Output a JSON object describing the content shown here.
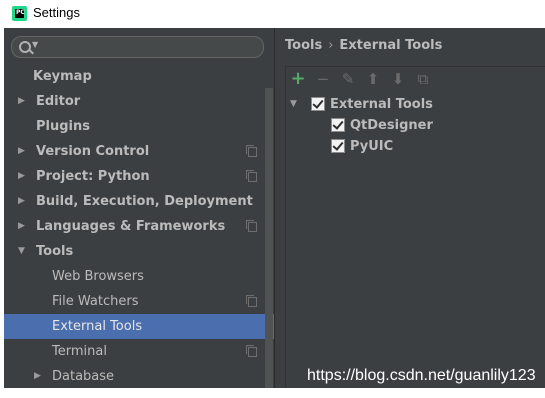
{
  "window": {
    "title": "Settings",
    "app_icon_text": "PC"
  },
  "search": {
    "placeholder": ""
  },
  "sidebar": {
    "items": [
      {
        "label": "Keymap",
        "arrow": ""
      },
      {
        "label": "Editor",
        "arrow": "▶"
      },
      {
        "label": "Plugins",
        "arrow": ""
      },
      {
        "label": "Version Control",
        "arrow": "▶"
      },
      {
        "label": "Project: Python",
        "arrow": "▶"
      },
      {
        "label": "Build, Execution, Deployment",
        "arrow": "▶"
      },
      {
        "label": "Languages & Frameworks",
        "arrow": "▶"
      },
      {
        "label": "Tools",
        "arrow": "▼"
      },
      {
        "label": "Web Browsers",
        "arrow": ""
      },
      {
        "label": "File Watchers",
        "arrow": ""
      },
      {
        "label": "External Tools",
        "arrow": "",
        "selected": true
      },
      {
        "label": "Terminal",
        "arrow": ""
      },
      {
        "label": "Database",
        "arrow": "▶"
      }
    ]
  },
  "breadcrumb": {
    "parent": "Tools",
    "separator": "›",
    "current": "External Tools"
  },
  "toolbar": {
    "add": "+",
    "remove": "−",
    "edit": "✎",
    "up": "⬆",
    "down": "⬇",
    "copy": "⧉"
  },
  "tools_tree": {
    "group": {
      "label": "External Tools",
      "arrow": "▼",
      "checked": true
    },
    "items": [
      {
        "label": "QtDesigner",
        "checked": true
      },
      {
        "label": "PyUIC",
        "checked": true
      }
    ]
  },
  "watermark": "https://blog.csdn.net/guanlily123",
  "colors": {
    "panel": "#3c3f41",
    "selection": "#4b6eaf",
    "text": "#bbbbbb",
    "add_green": "#59a869"
  }
}
